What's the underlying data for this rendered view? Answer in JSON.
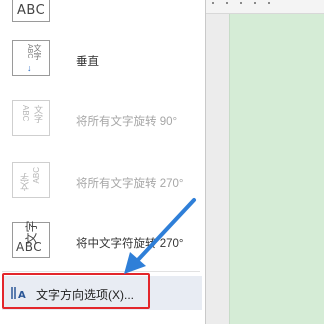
{
  "menu": {
    "top_item": {
      "icon_text": "ABC"
    },
    "items": [
      {
        "label": "垂直",
        "icon": "vertical-text-icon",
        "enabled": true
      },
      {
        "label": "将所有文字旋转 90°",
        "icon": "rotate-90-icon",
        "enabled": false
      },
      {
        "label": "将所有文字旋转 270°",
        "icon": "rotate-270-icon",
        "enabled": false
      },
      {
        "label": "将中文字符旋转 270°",
        "icon": "rotate-chinese-270-icon",
        "enabled": true
      }
    ],
    "icon_glyphs": {
      "vertical_chars_a": "文字",
      "vertical_chars_b": "ABC",
      "chinese_pair": "文字",
      "abc": "ABC"
    },
    "options": {
      "label": "文字方向选项(X)...",
      "icon": "text-direction-options-icon"
    }
  },
  "colors": {
    "highlight": "#e3262b",
    "arrow": "#2f7fd8",
    "page": "#d5ecd6",
    "selected_row": "#e8ecf3"
  }
}
